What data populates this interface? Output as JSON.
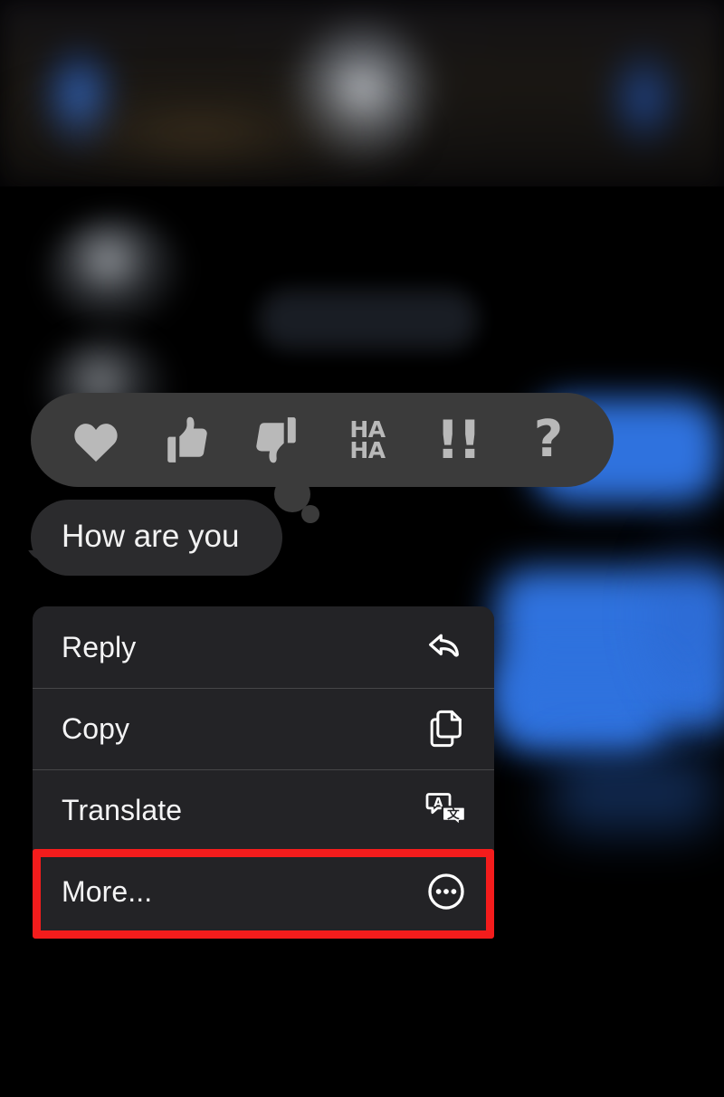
{
  "app": {
    "name": "messaging-app",
    "theme": "dark",
    "background_color": "#000000"
  },
  "background": {
    "description_alt": "blurred chat conversation behind modal",
    "header_avatar": "avatar-blob",
    "incoming_avatars": 2,
    "outgoing_bubble_color": "#2f72de",
    "incoming_bubble_color": "#1b1f26"
  },
  "reaction_bar": {
    "background_color": "#3b3b3b",
    "icon_color": "#b9b9b9",
    "reactions": [
      {
        "name": "heart-reaction",
        "icon": "heart-icon",
        "label": ""
      },
      {
        "name": "thumbs-up-reaction",
        "icon": "thumbs-up-icon",
        "label": ""
      },
      {
        "name": "thumbs-down-reaction",
        "icon": "thumbs-down-icon",
        "label": ""
      },
      {
        "name": "haha-reaction",
        "icon": "haha-text-icon",
        "label_line1": "HA",
        "label_line2": "HA"
      },
      {
        "name": "exclamation-reaction",
        "icon": "double-exclamation-icon",
        "label": "!!"
      },
      {
        "name": "question-reaction",
        "icon": "question-mark-icon",
        "label": "?"
      }
    ]
  },
  "message": {
    "text": "How are you",
    "direction": "incoming",
    "bubble_color": "#2b2b2d",
    "text_color": "#f2f2f2"
  },
  "context_menu": {
    "background_color": "#232326",
    "items": [
      {
        "label": "Reply",
        "icon": "reply-arrow-icon"
      },
      {
        "label": "Copy",
        "icon": "copy-pages-icon"
      },
      {
        "label": "Translate",
        "icon": "translate-icon"
      },
      {
        "label": "More...",
        "icon": "more-circle-ellipsis-icon"
      }
    ]
  },
  "annotation": {
    "highlight_color": "#f41c1c",
    "target": "More...",
    "shape": "rectangle"
  }
}
